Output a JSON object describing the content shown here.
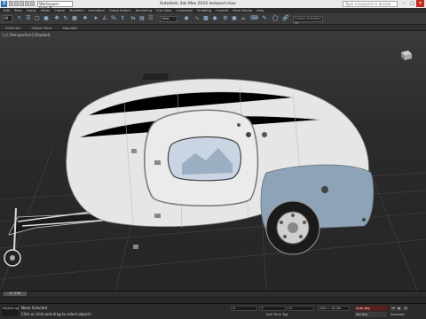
{
  "titlebar": {
    "workspace": "Workspace: Default",
    "title": "Autodesk 3ds Max 2016    kempert.max",
    "search_placeholder": "Type a keyword or phrase"
  },
  "menu": [
    "Edit",
    "Tools",
    "Group",
    "Views",
    "Create",
    "Modifiers",
    "Animation",
    "Graph Editors",
    "Rendering",
    "Civil View",
    "Customize",
    "Scripting",
    "Content",
    "Point Studio",
    "Help"
  ],
  "toolbar": {
    "selection_filter": "All",
    "view": "View",
    "named_selection": "Create Selection Se"
  },
  "ribbon_tabs": [
    "Selection",
    "Object Paint",
    "Populate"
  ],
  "viewport": {
    "label": "[+] [Perspective] [Shaded]"
  },
  "timeslider": {
    "frame": "0 / 100"
  },
  "status": {
    "script": "MAXScript",
    "selection": "None Selected",
    "prompt": "Click or click-and-drag to select objects",
    "add_time_tag": "Add Time Tag",
    "x": "X:",
    "y": "Y:",
    "z": "Z:",
    "grid": "Grid = 10,0m",
    "auto_key": "Auto Key",
    "set_key": "Set Key",
    "selected": "Selected"
  },
  "colors": {
    "accent_icon": "#9ec6ee",
    "trailer_body": "#e6e6e6",
    "fender": "#8fa3b8",
    "close_button": "#c42b1c"
  }
}
